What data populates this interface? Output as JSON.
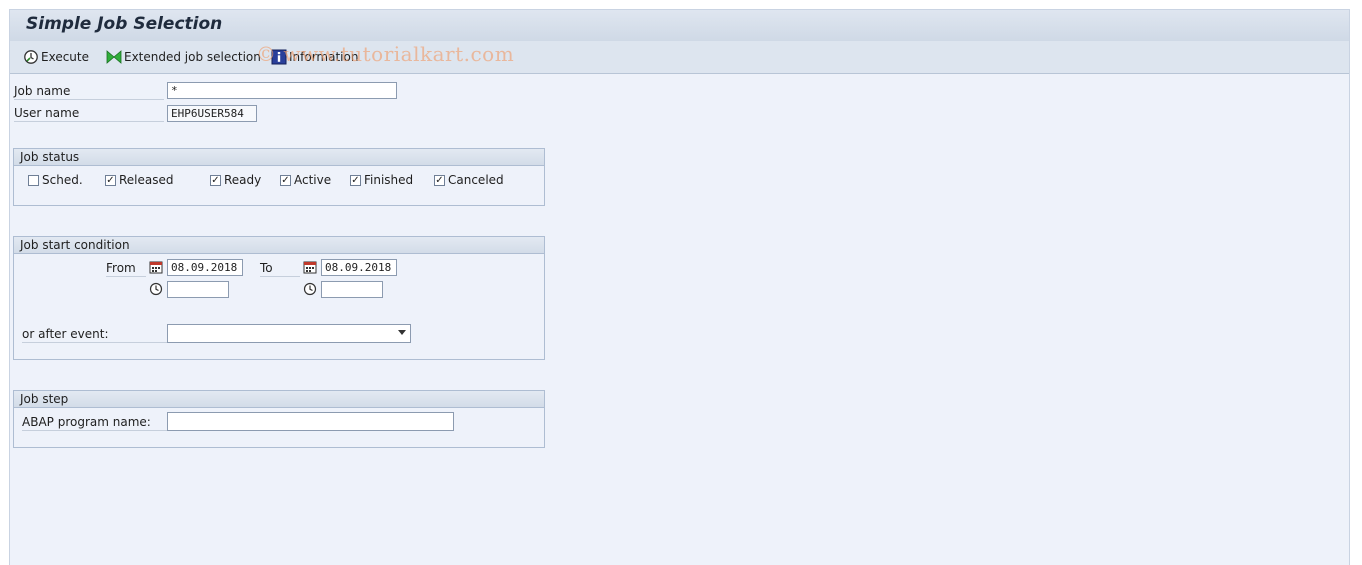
{
  "title": "Simple Job Selection",
  "toolbar": {
    "execute_label": "Execute",
    "extended_label": "Extended job selection",
    "information_label": "Information"
  },
  "watermark": "© www.tutorialkart.com",
  "fields": {
    "job_name_label": "Job name",
    "job_name_value": "*",
    "user_name_label": "User name",
    "user_name_value": "EHP6USER584"
  },
  "job_status": {
    "title": "Job status",
    "items": [
      {
        "label": "Sched.",
        "checked": false
      },
      {
        "label": "Released",
        "checked": true
      },
      {
        "label": "Ready",
        "checked": true
      },
      {
        "label": "Active",
        "checked": true
      },
      {
        "label": "Finished",
        "checked": true
      },
      {
        "label": "Canceled",
        "checked": true
      }
    ]
  },
  "start_condition": {
    "title": "Job start condition",
    "from_label": "From",
    "from_date": "08.09.2018",
    "from_time": "",
    "to_label": "To",
    "to_date": "08.09.2018",
    "to_time": "",
    "event_label": "or after event:",
    "event_value": ""
  },
  "job_step": {
    "title": "Job step",
    "program_label": "ABAP program name:",
    "program_value": ""
  },
  "colors": {
    "background": "#eef2fa",
    "header": "#dde5ef",
    "border": "#aebdd2"
  }
}
